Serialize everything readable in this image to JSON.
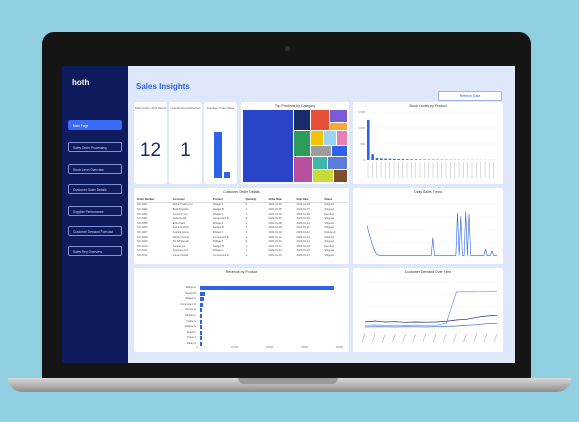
{
  "app": {
    "title": "Sales Insights",
    "logo": "hoth",
    "badge": "",
    "header_button": "Refresh Data"
  },
  "sidebar": {
    "items": [
      {
        "label": "Main Page"
      },
      {
        "label": "Sales Order Processing"
      },
      {
        "label": "Stock Level Overview"
      },
      {
        "label": "Customer Order Details"
      },
      {
        "label": "Supplier Performance"
      },
      {
        "label": "Customer Demand Forecast"
      },
      {
        "label": "Sales Rep Overview"
      }
    ]
  },
  "kpis": [
    {
      "label": "Total Orders This Month",
      "value": "12"
    },
    {
      "label": "Outstanding Deliveries",
      "value": "1"
    },
    {
      "label": "Average Order Value",
      "value": ""
    }
  ],
  "panels": {
    "treemap": "Top Products by Category",
    "top_bar": "Stock Levels by Product",
    "table": "Customer Order Details",
    "line1": "Daily Sales Trend",
    "hbar": "Revenue by Product",
    "line2": "Customer Demand Over Time"
  },
  "table": {
    "columns": [
      "Order Number",
      "Customer",
      "Product",
      "Quantity",
      "Order Date",
      "Ship Date",
      "Status"
    ],
    "rows": [
      [
        "SO-1001",
        "Alpha Trading Co",
        "Widget A",
        "5",
        "2024-01-04",
        "2024-01-06",
        "Shipped"
      ],
      [
        "SO-1002",
        "Beta Supplies",
        "Gadget B",
        "2",
        "2024-01-05",
        "2024-01-07",
        "Shipped"
      ],
      [
        "SO-1003",
        "Crescent Ltd",
        "Widget C",
        "1",
        "2024-01-06",
        "2024-01-08",
        "Pending"
      ],
      [
        "SO-1004",
        "Delta Retail",
        "Component D",
        "8",
        "2024-01-07",
        "2024-01-09",
        "Shipped"
      ],
      [
        "SO-1005",
        "Echo Parts",
        "Widget A",
        "3",
        "2024-01-08",
        "2024-01-10",
        "Shipped"
      ],
      [
        "SO-1006",
        "Fox Industries",
        "Gadget B",
        "4",
        "2024-01-09",
        "2024-01-11",
        "Shipped"
      ],
      [
        "SO-1007",
        "Granite Group",
        "Widget C",
        "6",
        "2024-01-10",
        "2024-01-12",
        "Delivered"
      ],
      [
        "SO-1008",
        "Harbor Goods",
        "Component D",
        "2",
        "2024-01-11",
        "2024-01-13",
        "Shipped"
      ],
      [
        "SO-1009",
        "Iris Wholesale",
        "Widget A",
        "9",
        "2024-01-12",
        "2024-01-14",
        "Shipped"
      ],
      [
        "SO-1010",
        "Juniper Co",
        "Gadget B",
        "1",
        "2024-01-13",
        "2024-01-15",
        "Pending"
      ],
      [
        "SO-1011",
        "Keystone Ltd",
        "Widget C",
        "7",
        "2024-01-14",
        "2024-01-16",
        "Shipped"
      ],
      [
        "SO-1012",
        "Lumen Retail",
        "Component D",
        "2",
        "2024-01-15",
        "2024-01-17",
        "Shipped"
      ]
    ]
  },
  "chart_data": [
    {
      "type": "bar",
      "title": "Stock Levels by Product",
      "ylim": [
        0,
        1500
      ],
      "yticks": [
        "1500",
        "1000",
        "500",
        "0"
      ],
      "values": [
        1250,
        180,
        60,
        50,
        45,
        40,
        35,
        30,
        28,
        25,
        22,
        20,
        18,
        16,
        14,
        12,
        11,
        10,
        9,
        8,
        7,
        6,
        5,
        5,
        4,
        4,
        3,
        3,
        2,
        2
      ]
    },
    {
      "type": "line",
      "title": "Daily Sales Trend",
      "values": [
        700,
        560,
        420,
        300,
        180,
        90,
        40,
        20,
        10,
        10,
        10,
        10,
        10,
        10,
        10,
        10,
        10,
        10,
        10,
        10,
        10,
        10,
        10,
        10,
        10,
        10,
        10,
        10,
        10,
        10,
        10,
        10,
        10,
        10,
        10,
        10,
        10,
        10,
        10,
        10,
        10,
        10,
        10,
        10,
        10,
        10,
        10,
        10,
        10,
        10,
        10,
        10,
        10,
        10,
        10,
        10,
        10,
        10,
        10,
        10,
        10,
        10,
        10,
        10,
        10,
        10,
        10,
        10,
        10,
        10,
        10,
        10,
        10,
        10,
        10,
        10,
        10,
        10,
        10,
        10
      ],
      "spikes": [
        [
          40,
          420
        ],
        [
          55,
          1000
        ],
        [
          57,
          920
        ],
        [
          60,
          1030
        ],
        [
          62,
          980
        ],
        [
          72,
          160
        ],
        [
          76,
          120
        ]
      ],
      "ylim": [
        0,
        1200
      ]
    },
    {
      "type": "bar",
      "orientation": "horizontal",
      "title": "Revenue by Product",
      "categories": [
        "Widget A",
        "Gadget B",
        "Widget C",
        "Component D",
        "Sensor E",
        "Module F",
        "Cable G",
        "Adapter H",
        "Switch I",
        "Panel J",
        "Relay K"
      ],
      "values": [
        43000,
        1600,
        1200,
        900,
        700,
        500,
        420,
        350,
        250,
        180,
        120
      ],
      "xticks": [
        "0",
        "10000",
        "20000",
        "30000",
        "40000"
      ]
    },
    {
      "type": "line",
      "title": "Customer Demand Over Time",
      "series": [
        {
          "color": "#6e8ff5",
          "values": [
            200,
            210,
            200,
            205,
            198,
            202,
            200,
            205,
            260,
            1200,
            1210,
            1205,
            1210,
            1210
          ]
        },
        {
          "color": "#1b2a6b",
          "values": [
            300,
            330,
            300,
            310,
            290,
            300,
            295,
            300,
            320,
            360,
            380,
            440,
            480,
            500
          ]
        },
        {
          "color": "#2d63e8",
          "values": [
            150,
            160,
            155,
            150,
            160,
            155,
            150,
            160,
            170,
            180,
            200,
            220,
            250,
            260
          ]
        }
      ],
      "ylim": [
        0,
        1500
      ]
    }
  ]
}
